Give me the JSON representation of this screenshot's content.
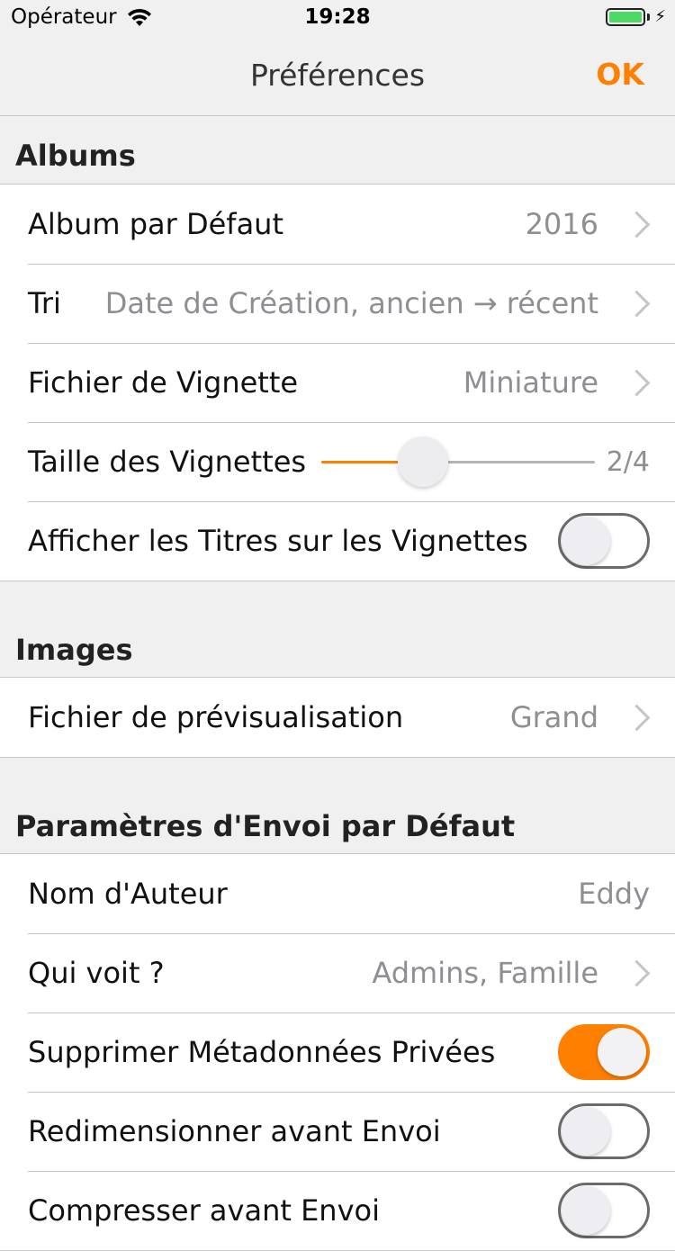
{
  "status": {
    "carrier": "Opérateur",
    "time": "19:28"
  },
  "nav": {
    "title": "Préférences",
    "ok": "OK"
  },
  "albums": {
    "header": "Albums",
    "default_album": {
      "label": "Album par Défaut",
      "value": "2016"
    },
    "sort": {
      "label": "Tri",
      "value": "Date de Création, ancien → récent"
    },
    "thumb_file": {
      "label": "Fichier de Vignette",
      "value": "Miniature"
    },
    "thumb_size": {
      "label": "Taille des Vignettes",
      "value": "2/4",
      "level": 0.37
    },
    "show_titles": {
      "label": "Afficher les Titres sur les Vignettes",
      "on": false
    }
  },
  "images": {
    "header": "Images",
    "preview_file": {
      "label": "Fichier de prévisualisation",
      "value": "Grand"
    }
  },
  "upload": {
    "header": "Paramètres d'Envoi par Défaut",
    "author": {
      "label": "Nom d'Auteur",
      "value": "Eddy"
    },
    "who_sees": {
      "label": "Qui voit ?",
      "value": "Admins, Famille"
    },
    "strip_metadata": {
      "label": "Supprimer Métadonnées Privées",
      "on": true
    },
    "resize": {
      "label": "Redimensionner avant Envoi",
      "on": false
    },
    "next_row": {
      "label": "Compresser avant Envoi",
      "on": false
    }
  },
  "colors": {
    "accent": "#ff7f00",
    "battery": "#4cd964"
  }
}
